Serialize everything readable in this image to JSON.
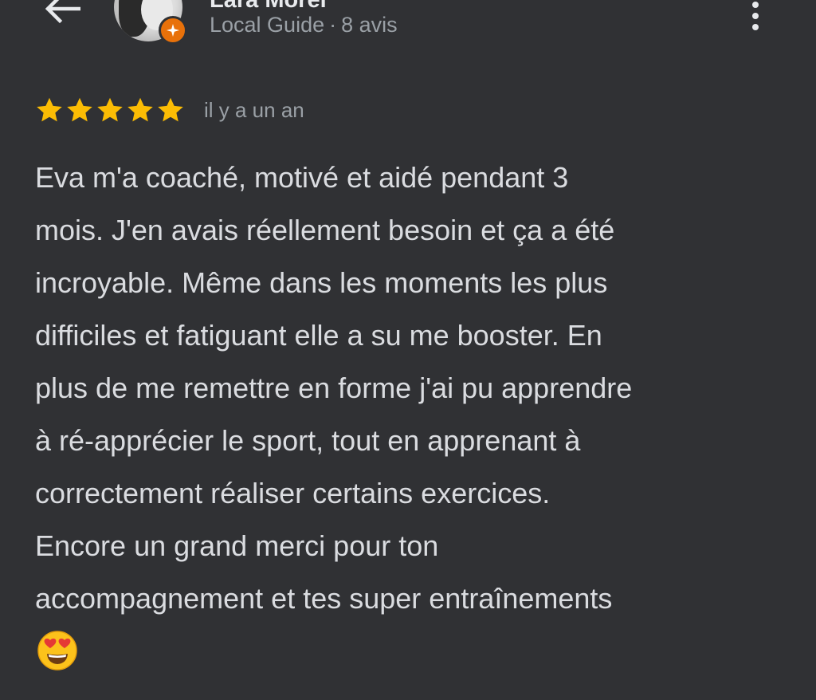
{
  "header": {
    "reviewer_name": "Lara Morel",
    "badge_label": "Local Guide",
    "separator": "·",
    "review_count": "8 avis"
  },
  "rating": {
    "stars": 5,
    "max_stars": 5,
    "star_color": "#fbbc04",
    "date": "il y a un an"
  },
  "review": {
    "text": "Eva m'a coaché, motivé et aidé pendant 3\nmois. J'en avais réellement besoin et ça a été\nincroyable. Même dans les moments les plus\ndifficiles et fatiguant elle a su me booster. En\nplus de me remettre en forme j'ai pu apprendre\nà ré-apprécier le sport, tout en apprenant à\ncorrectement réaliser certains exercices.\nEncore un grand merci pour ton\naccompagnement et tes super entraînements",
    "emoji": "heart-eyes-emoji"
  },
  "icons": {
    "back": "arrow-back-icon",
    "more": "more-vert-icon",
    "badge": "local-guide-badge-icon"
  },
  "colors": {
    "background": "#303134",
    "text": "#dadce0",
    "secondary_text": "#9aa0a6",
    "badge": "#e8710a"
  }
}
